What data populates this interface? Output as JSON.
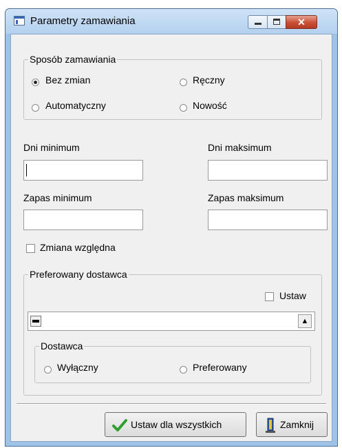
{
  "window": {
    "title": "Parametry zamawiania"
  },
  "order_method": {
    "legend": "Sposób zamawiania",
    "options": [
      {
        "label": "Bez zmian",
        "checked": true
      },
      {
        "label": "Ręczny",
        "checked": false
      },
      {
        "label": "Automatyczny",
        "checked": false
      },
      {
        "label": "Nowość",
        "checked": false
      }
    ]
  },
  "days_min": {
    "label": "Dni minimum",
    "value": ""
  },
  "days_max": {
    "label": "Dni maksimum",
    "value": ""
  },
  "stock_min": {
    "label": "Zapas minimum",
    "value": ""
  },
  "stock_max": {
    "label": "Zapas maksimum",
    "value": ""
  },
  "relative_change": {
    "label": "Zmiana względna",
    "checked": false
  },
  "preferred_supplier": {
    "legend": "Preferowany dostawca",
    "set_label": "Ustaw",
    "set_checked": false,
    "supplier_value": "",
    "supplier_group": {
      "legend": "Dostawca",
      "options": [
        {
          "label": "Wyłączny",
          "checked": false
        },
        {
          "label": "Preferowany",
          "checked": false
        }
      ]
    }
  },
  "buttons": {
    "set_all": "Ustaw dla wszystkich",
    "close": "Zamknij"
  },
  "colors": {
    "accent_check": "#2f9e2f",
    "close_button": "#c94f35"
  }
}
